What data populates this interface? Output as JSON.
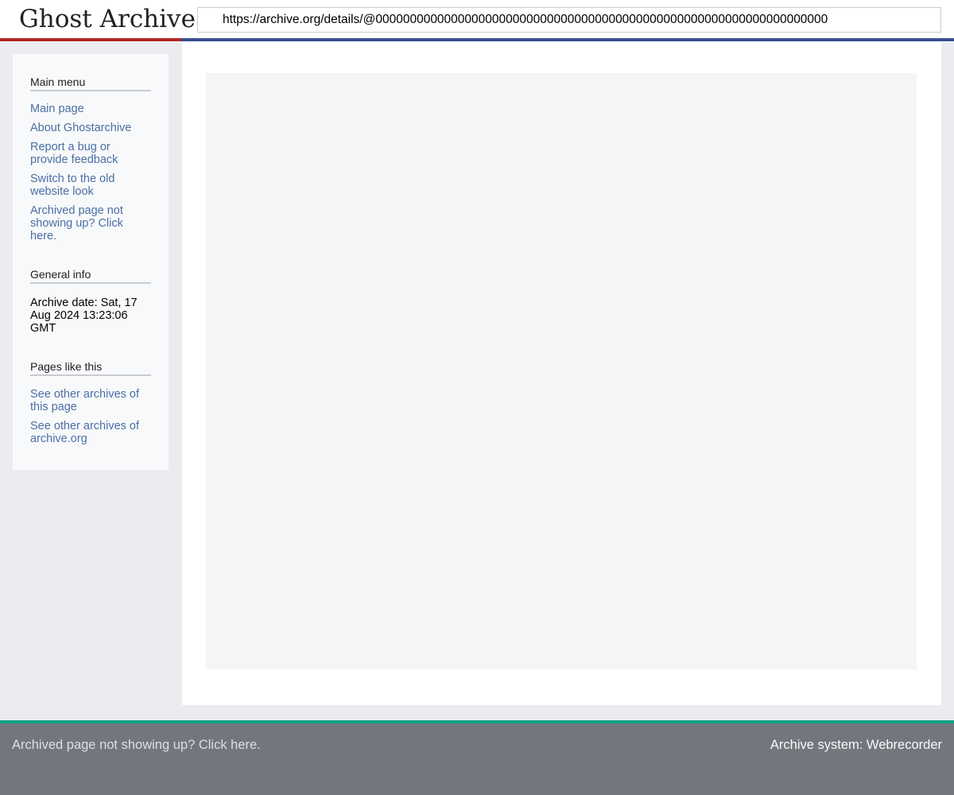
{
  "header": {
    "logo": "Ghost Archive",
    "url_value": "https://archive.org/details/@000000000000000000000000000000000000000000000000000000000000000000"
  },
  "sidebar": {
    "main_menu": {
      "title": "Main menu",
      "items": [
        {
          "label": "Main page"
        },
        {
          "label": "About Ghostarchive"
        },
        {
          "label": "Report a bug or provide feedback"
        },
        {
          "label": "Switch to the old website look"
        },
        {
          "label": "Archived page not showing up? Click here."
        }
      ]
    },
    "general_info": {
      "title": "General info",
      "archive_date": "Archive date: Sat, 17 Aug 2024 13:23:06 GMT"
    },
    "pages_like_this": {
      "title": "Pages like this",
      "items": [
        {
          "label": "See other archives of this page"
        },
        {
          "label": "See other archives of archive.org"
        }
      ]
    }
  },
  "footer": {
    "left_link": "Archived page not showing up? Click here.",
    "right_text": "Archive system: Webrecorder"
  },
  "colors": {
    "link": "#4a6fa5",
    "accent_red": "#b32424",
    "accent_blue": "#36508f",
    "footer_accent": "#14a085",
    "footer_bg": "#72777d"
  }
}
